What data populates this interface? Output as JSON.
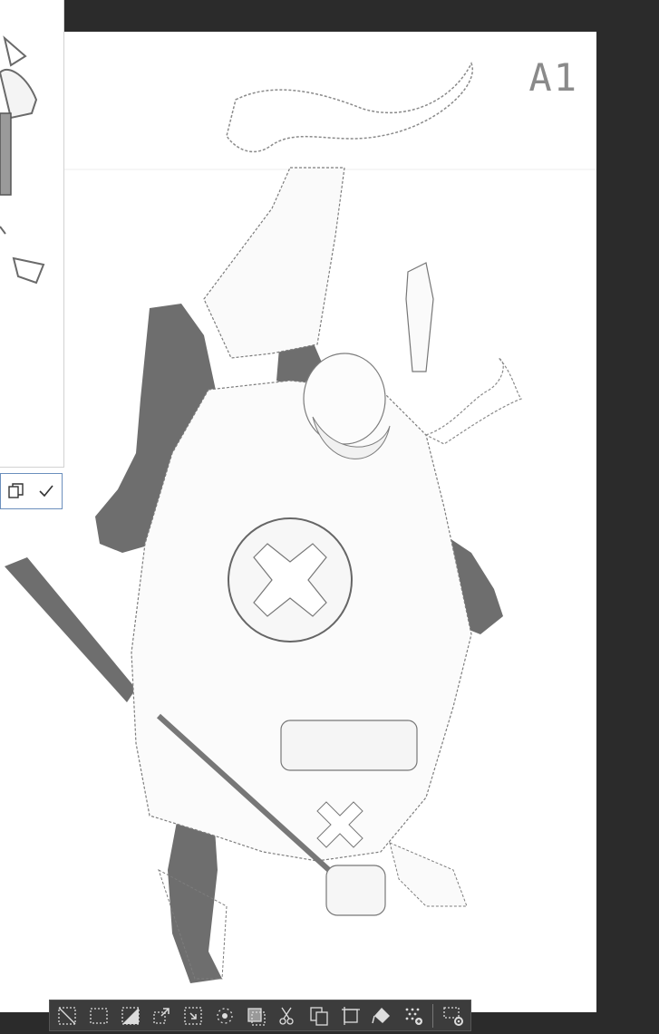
{
  "canvas": {
    "label": "A1"
  },
  "confirm_bar": {
    "copy_icon": "copy-icon",
    "confirm_icon": "checkmark-icon"
  },
  "selection_toolbar": {
    "tools": [
      "deselect-icon",
      "select-all-icon",
      "invert-selection-icon",
      "expand-selection-icon",
      "shrink-selection-icon",
      "feather-selection-icon",
      "selection-border-icon",
      "cut-icon",
      "copy-paste-icon",
      "transform-icon",
      "fill-icon",
      "selection-pattern-icon",
      "selection-settings-icon"
    ]
  },
  "colors": {
    "background": "#2b2b2b",
    "canvas": "#ffffff",
    "toolbar": "#3c3c3c",
    "accent_border": "#6b8fbd"
  }
}
